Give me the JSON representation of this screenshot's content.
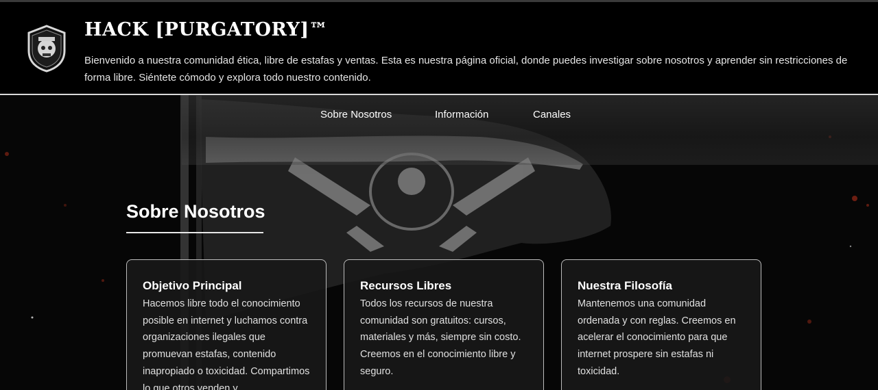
{
  "header": {
    "title": "HACK [PURGATORY]™",
    "description": "Bienvenido a nuestra comunidad ética, libre de estafas y ventas. Esta es nuestra página oficial, donde puedes investigar sobre nosotros y aprender sin restricciones de forma libre. Siéntete cómodo y explora todo nuestro contenido."
  },
  "nav": {
    "items": [
      {
        "label": "Sobre Nosotros"
      },
      {
        "label": "Información"
      },
      {
        "label": "Canales"
      }
    ]
  },
  "section": {
    "title": "Sobre Nosotros",
    "cards": [
      {
        "title": "Objetivo Principal",
        "body": "Hacemos libre todo el conocimiento posible en internet y luchamos contra organizaciones ilegales que promuevan estafas, contenido inapropiado o toxicidad. Compartimos lo que otros venden y"
      },
      {
        "title": "Recursos Libres",
        "body": "Todos los recursos de nuestra comunidad son gratuitos: cursos, materiales y más, siempre sin costo. Creemos en el conocimiento libre y seguro."
      },
      {
        "title": "Nuestra Filosofía",
        "body": "Mantenemos una comunidad ordenada y con reglas. Creemos en acelerar el conocimiento para que internet prospere sin estafas ni toxicidad."
      }
    ]
  },
  "icons": {
    "logo": "shield-skull-emblem",
    "background": "flag-with-emblem"
  },
  "colors": {
    "background": "#060606",
    "header_bg": "#000000",
    "text": "#ffffff",
    "card_border": "#bdbdbd",
    "ember": "#8a1f12"
  }
}
